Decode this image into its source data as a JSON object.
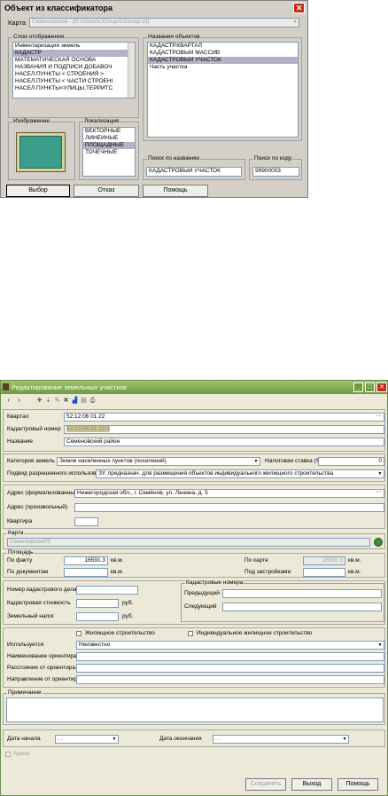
{
  "classifier": {
    "title": "Объект из классификатора",
    "map_label": "Карта",
    "map_value": "Семеновский - [D:\\share\\k33map\\k33map.sit]",
    "layers_legend": "Слои отображения",
    "layers": [
      "Инвентаризация земель",
      "КАДАСТР",
      "МАТЕМАТИЧЕСКАЯ ОСНОВА",
      "НАЗВАНИЯ И ПОДПИСИ ДОБАВОЧ",
      "НАСЕЛ.ПУНКТЫ < СТРОЕНИЯ >",
      "НАСЕЛ.ПУНКТЫ < ЧАСТИ СТРОЕНІ",
      "НАСЕЛ.ПУНКТЫ<УЛИЦЫ,ТЕРРИТС"
    ],
    "objects_legend": "Названия объектов",
    "objects": [
      "КАДАСТР.КВАРТАЛ",
      "КАДАСТРОВЫЙ МАССИВ",
      "КАДАСТРОВЫЙ УЧАСТОК",
      "Часть участка"
    ],
    "image_legend": "Изображение",
    "swatch_color": "#3a9e8a",
    "localization_legend": "Локализация",
    "localizations": [
      "ВЕКТОРНЫЕ",
      "ЛИНЕЙНЫЕ",
      "ПЛОЩАДНЫЕ",
      "ТОЧЕЧНЫЕ"
    ],
    "search_name_legend": "Поиск по названию",
    "search_name_value": "КАДАСТРОВЫЙ УЧАСТОК",
    "search_code_legend": "Поиск по коду",
    "search_code_value": "99900003",
    "btn_select": "Выбор",
    "btn_cancel": "Отказ",
    "btn_help": "Помощь"
  },
  "editor": {
    "title": "Редактирование земельных участков",
    "quarter_label": "Квартал",
    "quarter_value": "52:12:06 01 22",
    "cad_number_label": "Кадастровый номер",
    "cad_number_value": "52:12:06 01 22:2",
    "name_label": "Название",
    "name_value": "Семеновский район",
    "category_label": "Категория земель",
    "category_value": "Земли населенных пунктов (поселений)",
    "tax_label": "Налоговая ставка (%)",
    "tax_value": "0",
    "use_label": "Подвид разрешенного использова",
    "use_value": "ЗУ, предназнач. для размещения объектов индивидуального жилищного строительства",
    "address_formal_label": "Адрес (формализованный)",
    "address_formal_value": "Нижегородская обл., г. Семёнов, ул. Ленина, д. 5",
    "address_free_label": "Адрес (произвольный)",
    "address_free_value": "",
    "apartment_label": "Квартира",
    "apartment_value": "",
    "map_legend": "Карта",
    "map_value": "Семеновский/5",
    "area_legend": "Площадь",
    "actual_label": "По факту",
    "actual_value": "16591.3",
    "unit": "кв.м.",
    "by_docs_label": "По документам",
    "by_docs_value": "",
    "by_map_label": "По карте",
    "by_map_value": "16591.3",
    "built_label": "Под застройками",
    "built_value": "",
    "case_label": "Номер кадастрового дела",
    "case_value": "",
    "cad_cost_label": "Кадастровая стоимость",
    "cad_cost_value": "",
    "rub": "руб.",
    "land_tax_label": "Земельный налог",
    "land_tax_value": "",
    "cad_numbers_legend": "Кадастровые номера",
    "prev_label": "Предыдущий",
    "prev_value": "",
    "next_label": "Следующий",
    "next_value": "",
    "housing_label": "Жилищное строительство",
    "individual_label": "Индивидуальное жилищное строительство",
    "used_label": "Используется",
    "used_value": "Неизвестно",
    "landmark_name_label": "Наименование ориентира",
    "landmark_dist_label": "Расстояние от ориентира",
    "landmark_dir_label": "Направление от ориентира",
    "note_legend": "Примечание",
    "start_label": "Дата начала",
    "start_value": ". .",
    "end_label": "Дата окончания",
    "end_value": ". .",
    "archive_label": "Архив",
    "btn_save": "Сохранить",
    "btn_exit": "Выход",
    "btn_help": "Помощь"
  }
}
